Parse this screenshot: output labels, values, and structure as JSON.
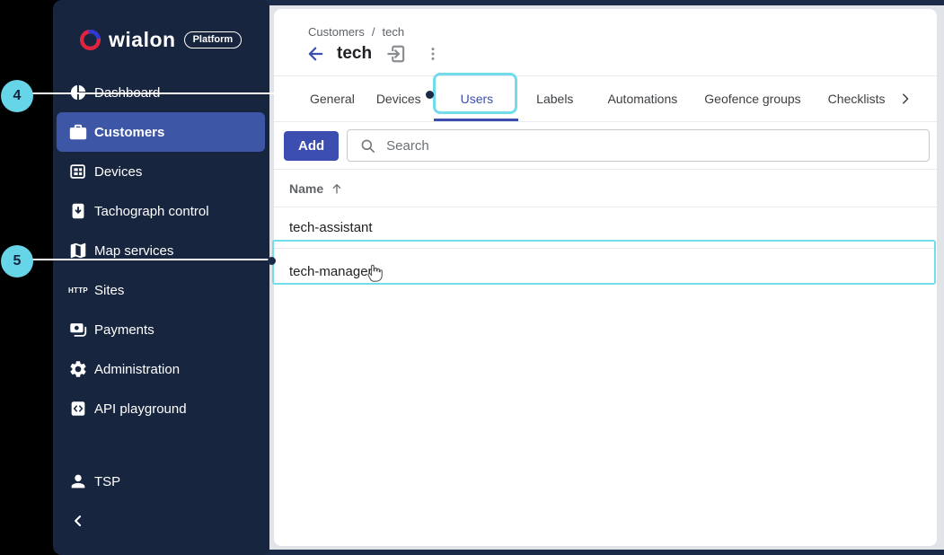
{
  "colors": {
    "accent": "#3d4eb1",
    "sidebar_bg": "#17253f",
    "sidebar_selected": "#3d56a6",
    "annotation_cyan": "#66d5e7",
    "frame_navy": "#1b2a47"
  },
  "annotations": {
    "badge_4": "4",
    "badge_5": "5"
  },
  "sidebar": {
    "logo": {
      "brand": "wialon",
      "badge": "Platform"
    },
    "items": [
      {
        "label": "Dashboard"
      },
      {
        "label": "Customers"
      },
      {
        "label": "Devices"
      },
      {
        "label": "Tachograph control"
      },
      {
        "label": "Map services"
      },
      {
        "label": "Sites"
      },
      {
        "label": "Payments"
      },
      {
        "label": "Administration"
      },
      {
        "label": "API playground"
      }
    ],
    "sites_icon_text": "HTTP",
    "footer": {
      "label": "TSP"
    }
  },
  "header": {
    "breadcrumb": [
      "Customers",
      "tech"
    ],
    "separator": "/",
    "title": "tech"
  },
  "tabs": [
    {
      "label": "General"
    },
    {
      "label": "Devices"
    },
    {
      "label": "Users"
    },
    {
      "label": "Labels"
    },
    {
      "label": "Automations"
    },
    {
      "label": "Geofence groups"
    },
    {
      "label": "Checklists"
    }
  ],
  "toolbar": {
    "add_label": "Add",
    "search_placeholder": "Search"
  },
  "table": {
    "sort_column": "Name",
    "rows": [
      {
        "name": "tech-assistant"
      },
      {
        "name": "tech-manager"
      }
    ]
  }
}
